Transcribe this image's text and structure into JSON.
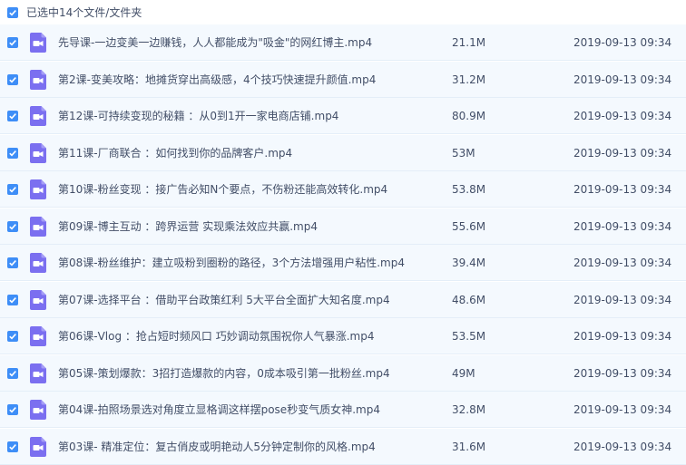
{
  "header": {
    "title": "已选中14个文件/文件夹",
    "checked": true
  },
  "files": [
    {
      "name": "先导课-一边变美一边赚钱，人人都能成为\"吸金\"的网红博主.mp4",
      "size": "21.1M",
      "date": "2019-09-13 09:34",
      "checked": true,
      "icon": "video-file-icon"
    },
    {
      "name": "第2课-变美攻略：地摊货穿出高级感，4个技巧快速提升颜值.mp4",
      "size": "31.2M",
      "date": "2019-09-13 09:34",
      "checked": true,
      "icon": "video-file-icon"
    },
    {
      "name": "第12课-可持续变现的秘籍 ：从0到1开一家电商店铺.mp4",
      "size": "80.9M",
      "date": "2019-09-13 09:34",
      "checked": true,
      "icon": "video-file-icon"
    },
    {
      "name": "第11课-厂商联合 ：如何找到你的品牌客户.mp4",
      "size": "53M",
      "date": "2019-09-13 09:34",
      "checked": true,
      "icon": "video-file-icon"
    },
    {
      "name": "第10课-粉丝变现 ：接广告必知N个要点，不伤粉还能高效转化.mp4",
      "size": "53.8M",
      "date": "2019-09-13 09:34",
      "checked": true,
      "icon": "video-file-icon"
    },
    {
      "name": "第09课-博主互动 ：跨界运营 实现乘法效应共赢.mp4",
      "size": "55.6M",
      "date": "2019-09-13 09:34",
      "checked": true,
      "icon": "video-file-icon"
    },
    {
      "name": "第08课-粉丝维护：建立吸粉到圈粉的路径，3个方法增强用户粘性.mp4",
      "size": "39.4M",
      "date": "2019-09-13 09:34",
      "checked": true,
      "icon": "video-file-icon"
    },
    {
      "name": "第07课-选择平台 ：借助平台政策红利 5大平台全面扩大知名度.mp4",
      "size": "48.6M",
      "date": "2019-09-13 09:34",
      "checked": true,
      "icon": "video-file-icon"
    },
    {
      "name": "第06课-Vlog ：抢占短时频风口 巧妙调动氛围祝你人气暴涨.mp4",
      "size": "53.5M",
      "date": "2019-09-13 09:34",
      "checked": true,
      "icon": "video-file-icon"
    },
    {
      "name": "第05课-策划爆款：3招打造爆款的内容，0成本吸引第一批粉丝.mp4",
      "size": "49M",
      "date": "2019-09-13 09:34",
      "checked": true,
      "icon": "video-file-icon"
    },
    {
      "name": "第04课-拍照场景选对角度立显格调这样摆pose秒变气质女神.mp4",
      "size": "32.8M",
      "date": "2019-09-13 09:34",
      "checked": true,
      "icon": "video-file-icon"
    },
    {
      "name": "第03课- 精准定位：复古俏皮或明艳动人5分钟定制你的风格.mp4",
      "size": "31.6M",
      "date": "2019-09-13 09:34",
      "checked": true,
      "icon": "video-file-icon"
    }
  ],
  "colors": {
    "checkbox": "#3e8ef7",
    "video_icon": "#7b6ff0",
    "row_bg": "#f4f9fe",
    "text": "#424e67"
  }
}
